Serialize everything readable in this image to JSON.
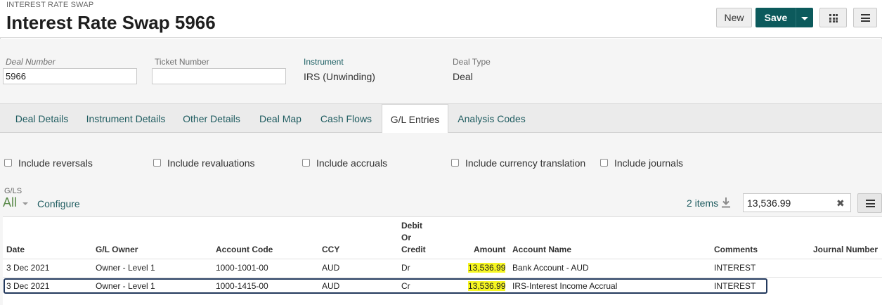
{
  "header": {
    "subtitle": "INTEREST RATE SWAP",
    "title": "Interest Rate Swap 5966",
    "new_label": "New",
    "save_label": "Save"
  },
  "fields": {
    "deal_number": {
      "label": "Deal Number",
      "value": "5966"
    },
    "ticket_number": {
      "label": "Ticket Number",
      "value": ""
    },
    "instrument": {
      "label": "Instrument",
      "value": "IRS (Unwinding)"
    },
    "deal_type": {
      "label": "Deal Type",
      "value": "Deal"
    }
  },
  "tabs": [
    {
      "label": "Deal Details",
      "active": false
    },
    {
      "label": "Instrument Details",
      "active": false
    },
    {
      "label": "Other Details",
      "active": false
    },
    {
      "label": "Deal Map",
      "active": false
    },
    {
      "label": "Cash Flows",
      "active": false
    },
    {
      "label": "G/L Entries",
      "active": true
    },
    {
      "label": "Analysis Codes",
      "active": false
    }
  ],
  "filters": [
    {
      "label": "Include reversals",
      "checked": false
    },
    {
      "label": "Include revaluations",
      "checked": false
    },
    {
      "label": "Include accruals",
      "checked": false
    },
    {
      "label": "Include currency translation",
      "checked": false
    },
    {
      "label": "Include journals",
      "checked": false
    }
  ],
  "list": {
    "section_label": "G/LS",
    "view_label": "All",
    "configure_label": "Configure",
    "item_count": "2 items",
    "search_value": "13,536.99"
  },
  "table": {
    "columns": {
      "date": "Date",
      "gl_owner": "G/L Owner",
      "account_code": "Account Code",
      "ccy": "CCY",
      "debit_or_credit_1": "Debit",
      "debit_or_credit_2": "Or",
      "debit_or_credit_3": "Credit",
      "amount": "Amount",
      "account_name": "Account Name",
      "comments": "Comments",
      "journal_number": "Journal Number"
    },
    "rows": [
      {
        "date": "3 Dec 2021",
        "gl_owner": "Owner - Level 1",
        "account_code": "1000-1001-00",
        "ccy": "AUD",
        "dc": "Dr",
        "amount": "13,536.99",
        "account_name": "Bank Account - AUD",
        "comments": "INTEREST",
        "journal_number": ""
      },
      {
        "date": "3 Dec 2021",
        "gl_owner": "Owner - Level 1",
        "account_code": "1000-1415-00",
        "ccy": "AUD",
        "dc": "Cr",
        "amount": "13,536.99",
        "account_name": "IRS-Interest Income Accrual",
        "comments": "INTEREST",
        "journal_number": ""
      }
    ]
  },
  "colors": {
    "accent": "#0c5a5c",
    "link": "#1f5c60",
    "highlight": "#f6f623",
    "selection_border": "#23395d"
  }
}
